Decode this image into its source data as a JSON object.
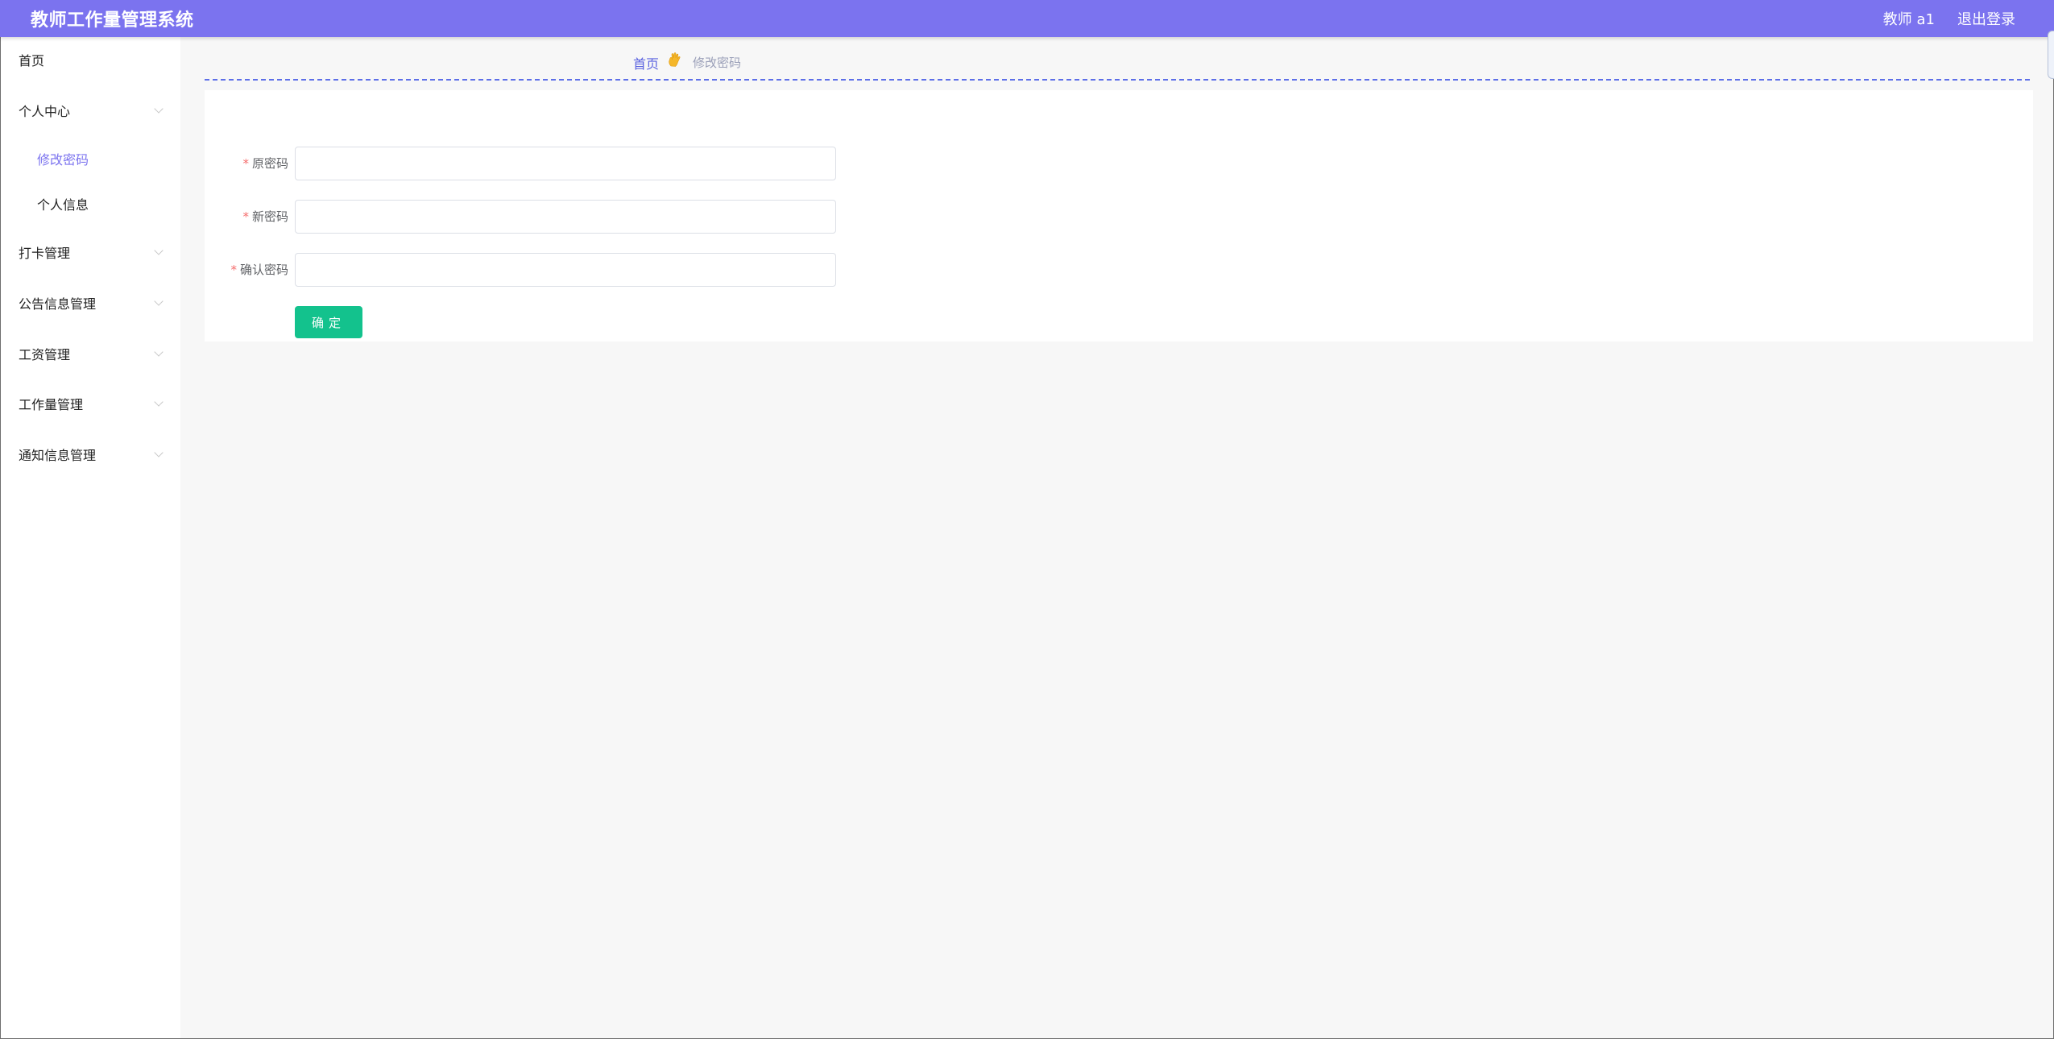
{
  "header": {
    "title": "教师工作量管理系统",
    "user_label": "教师 a1",
    "logout_label": "退出登录",
    "background_color": "#7b73ef"
  },
  "sidebar": {
    "items": [
      {
        "label": "首页",
        "expandable": false
      },
      {
        "label": "个人中心",
        "expandable": true
      },
      {
        "label": "修改密码",
        "sub": true,
        "active": true
      },
      {
        "label": "个人信息",
        "sub": true
      },
      {
        "label": "打卡管理",
        "expandable": true
      },
      {
        "label": "公告信息管理",
        "expandable": true
      },
      {
        "label": "工资管理",
        "expandable": true
      },
      {
        "label": "工作量管理",
        "expandable": true
      },
      {
        "label": "通知信息管理",
        "expandable": true
      }
    ],
    "active_color": "#7b73ef"
  },
  "breadcrumb": {
    "home": "首页",
    "separator_icon": "hand-icon",
    "current": "修改密码"
  },
  "form": {
    "fields": [
      {
        "label": "原密码",
        "required": true,
        "value": ""
      },
      {
        "label": "新密码",
        "required": true,
        "value": ""
      },
      {
        "label": "确认密码",
        "required": true,
        "value": ""
      }
    ],
    "required_mark": "*",
    "submit_label": "确定",
    "submit_color": "#13c28d"
  }
}
